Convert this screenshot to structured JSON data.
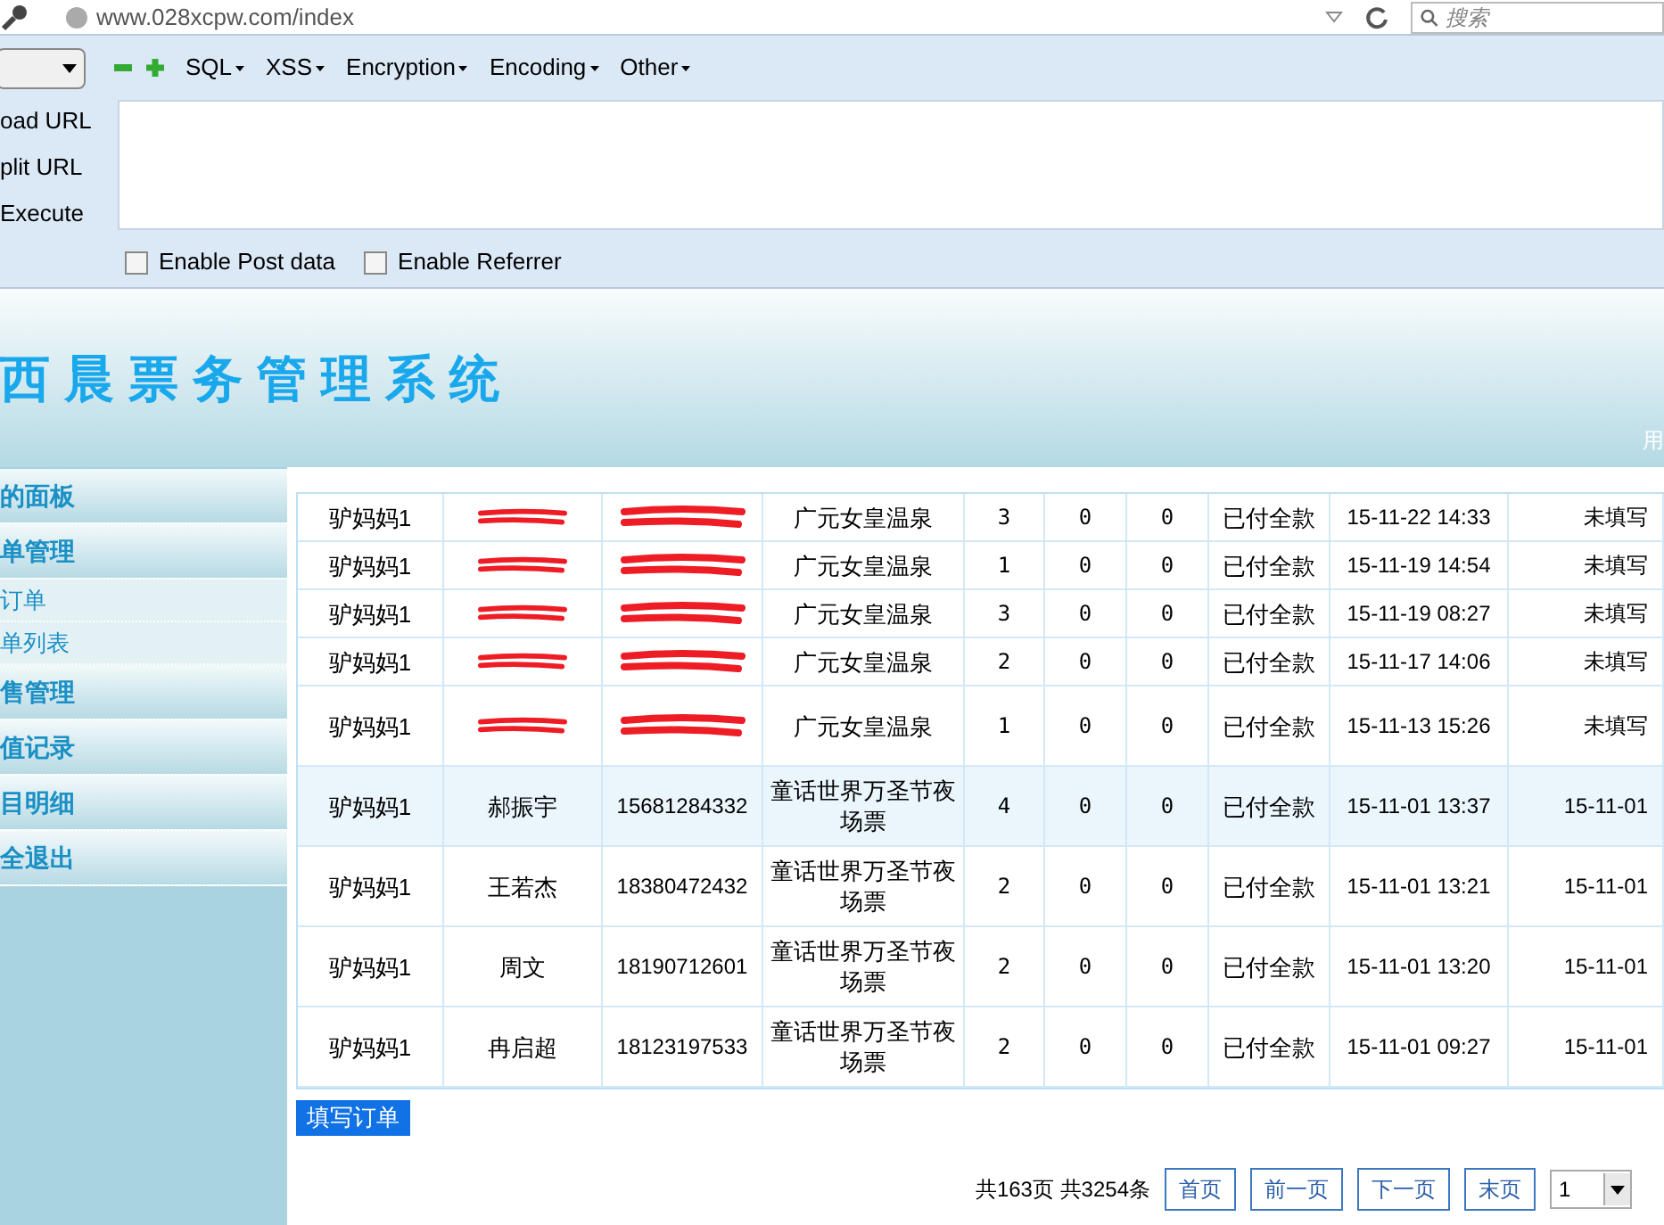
{
  "browser": {
    "url": "www.028xcpw.com/index",
    "search": {
      "placeholder": "搜索"
    }
  },
  "hackbar": {
    "menus": [
      "SQL",
      "XSS",
      "Encryption",
      "Encoding",
      "Other"
    ],
    "actions": [
      "oad URL",
      "plit URL",
      "Execute"
    ],
    "options": [
      {
        "label": "Enable Post data",
        "checked": false
      },
      {
        "label": "Enable Referrer",
        "checked": false
      }
    ]
  },
  "banner": {
    "title": "西晨票务管理系统",
    "user": "用"
  },
  "sidebar": {
    "items": [
      {
        "label": "的面板",
        "kind": "header"
      },
      {
        "label": "单管理",
        "kind": "header"
      },
      {
        "label": "订单",
        "kind": "sub"
      },
      {
        "label": "单列表",
        "kind": "sub"
      },
      {
        "label": "售管理",
        "kind": "header"
      },
      {
        "label": "值记录",
        "kind": "header"
      },
      {
        "label": "目明细",
        "kind": "header"
      },
      {
        "label": "全退出",
        "kind": "header"
      }
    ]
  },
  "table": {
    "rows": [
      {
        "selected": false,
        "tall": false,
        "cells": [
          {
            "text": "驴妈妈1"
          },
          {
            "redacted": true
          },
          {
            "redacted": true
          },
          {
            "text": "广元女皇温泉"
          },
          {
            "text": "3"
          },
          {
            "text": "0"
          },
          {
            "text": "0"
          },
          {
            "text": "已付全款"
          },
          {
            "text": "15-11-22 14:33"
          },
          {
            "text": "未填写"
          }
        ]
      },
      {
        "selected": false,
        "tall": false,
        "cells": [
          {
            "text": "驴妈妈1"
          },
          {
            "redacted": true
          },
          {
            "redacted": true
          },
          {
            "text": "广元女皇温泉"
          },
          {
            "text": "1"
          },
          {
            "text": "0"
          },
          {
            "text": "0"
          },
          {
            "text": "已付全款"
          },
          {
            "text": "15-11-19 14:54"
          },
          {
            "text": "未填写"
          }
        ]
      },
      {
        "selected": false,
        "tall": false,
        "cells": [
          {
            "text": "驴妈妈1"
          },
          {
            "redacted": true
          },
          {
            "redacted": true
          },
          {
            "text": "广元女皇温泉"
          },
          {
            "text": "3"
          },
          {
            "text": "0"
          },
          {
            "text": "0"
          },
          {
            "text": "已付全款"
          },
          {
            "text": "15-11-19 08:27"
          },
          {
            "text": "未填写"
          }
        ]
      },
      {
        "selected": false,
        "tall": false,
        "cells": [
          {
            "text": "驴妈妈1"
          },
          {
            "redacted": true
          },
          {
            "redacted": true
          },
          {
            "text": "广元女皇温泉"
          },
          {
            "text": "2"
          },
          {
            "text": "0"
          },
          {
            "text": "0"
          },
          {
            "text": "已付全款"
          },
          {
            "text": "15-11-17 14:06"
          },
          {
            "text": "未填写"
          }
        ]
      },
      {
        "selected": false,
        "tall": true,
        "cells": [
          {
            "text": "驴妈妈1"
          },
          {
            "redacted": true
          },
          {
            "redacted": true
          },
          {
            "text": "广元女皇温泉"
          },
          {
            "text": "1"
          },
          {
            "text": "0"
          },
          {
            "text": "0"
          },
          {
            "text": "已付全款"
          },
          {
            "text": "15-11-13 15:26"
          },
          {
            "text": "未填写"
          }
        ]
      },
      {
        "selected": true,
        "tall": true,
        "cells": [
          {
            "text": "驴妈妈1"
          },
          {
            "text": "郝振宇"
          },
          {
            "text": "15681284332"
          },
          {
            "text": "童话世界万圣节夜场票"
          },
          {
            "text": "4"
          },
          {
            "text": "0"
          },
          {
            "text": "0"
          },
          {
            "text": "已付全款"
          },
          {
            "text": "15-11-01 13:37"
          },
          {
            "text": "15-11-01"
          }
        ]
      },
      {
        "selected": false,
        "tall": true,
        "cells": [
          {
            "text": "驴妈妈1"
          },
          {
            "text": "王若杰"
          },
          {
            "text": "18380472432"
          },
          {
            "text": "童话世界万圣节夜场票"
          },
          {
            "text": "2"
          },
          {
            "text": "0"
          },
          {
            "text": "0"
          },
          {
            "text": "已付全款"
          },
          {
            "text": "15-11-01 13:21"
          },
          {
            "text": "15-11-01"
          }
        ]
      },
      {
        "selected": false,
        "tall": true,
        "cells": [
          {
            "text": "驴妈妈1"
          },
          {
            "text": "周文"
          },
          {
            "text": "18190712601"
          },
          {
            "text": "童话世界万圣节夜场票"
          },
          {
            "text": "2"
          },
          {
            "text": "0"
          },
          {
            "text": "0"
          },
          {
            "text": "已付全款"
          },
          {
            "text": "15-11-01 13:20"
          },
          {
            "text": "15-11-01"
          }
        ]
      },
      {
        "selected": false,
        "tall": true,
        "cells": [
          {
            "text": "驴妈妈1"
          },
          {
            "text": "冉启超"
          },
          {
            "text": "18123197533"
          },
          {
            "text": "童话世界万圣节夜场票"
          },
          {
            "text": "2"
          },
          {
            "text": "0"
          },
          {
            "text": "0"
          },
          {
            "text": "已付全款"
          },
          {
            "text": "15-11-01 09:27"
          },
          {
            "text": "15-11-01"
          }
        ]
      }
    ]
  },
  "new_order_button": "填写订单",
  "pagination": {
    "summary": "共163页 共3254条",
    "buttons": [
      "首页",
      "前一页",
      "下一页",
      "末页"
    ],
    "page": "1"
  }
}
